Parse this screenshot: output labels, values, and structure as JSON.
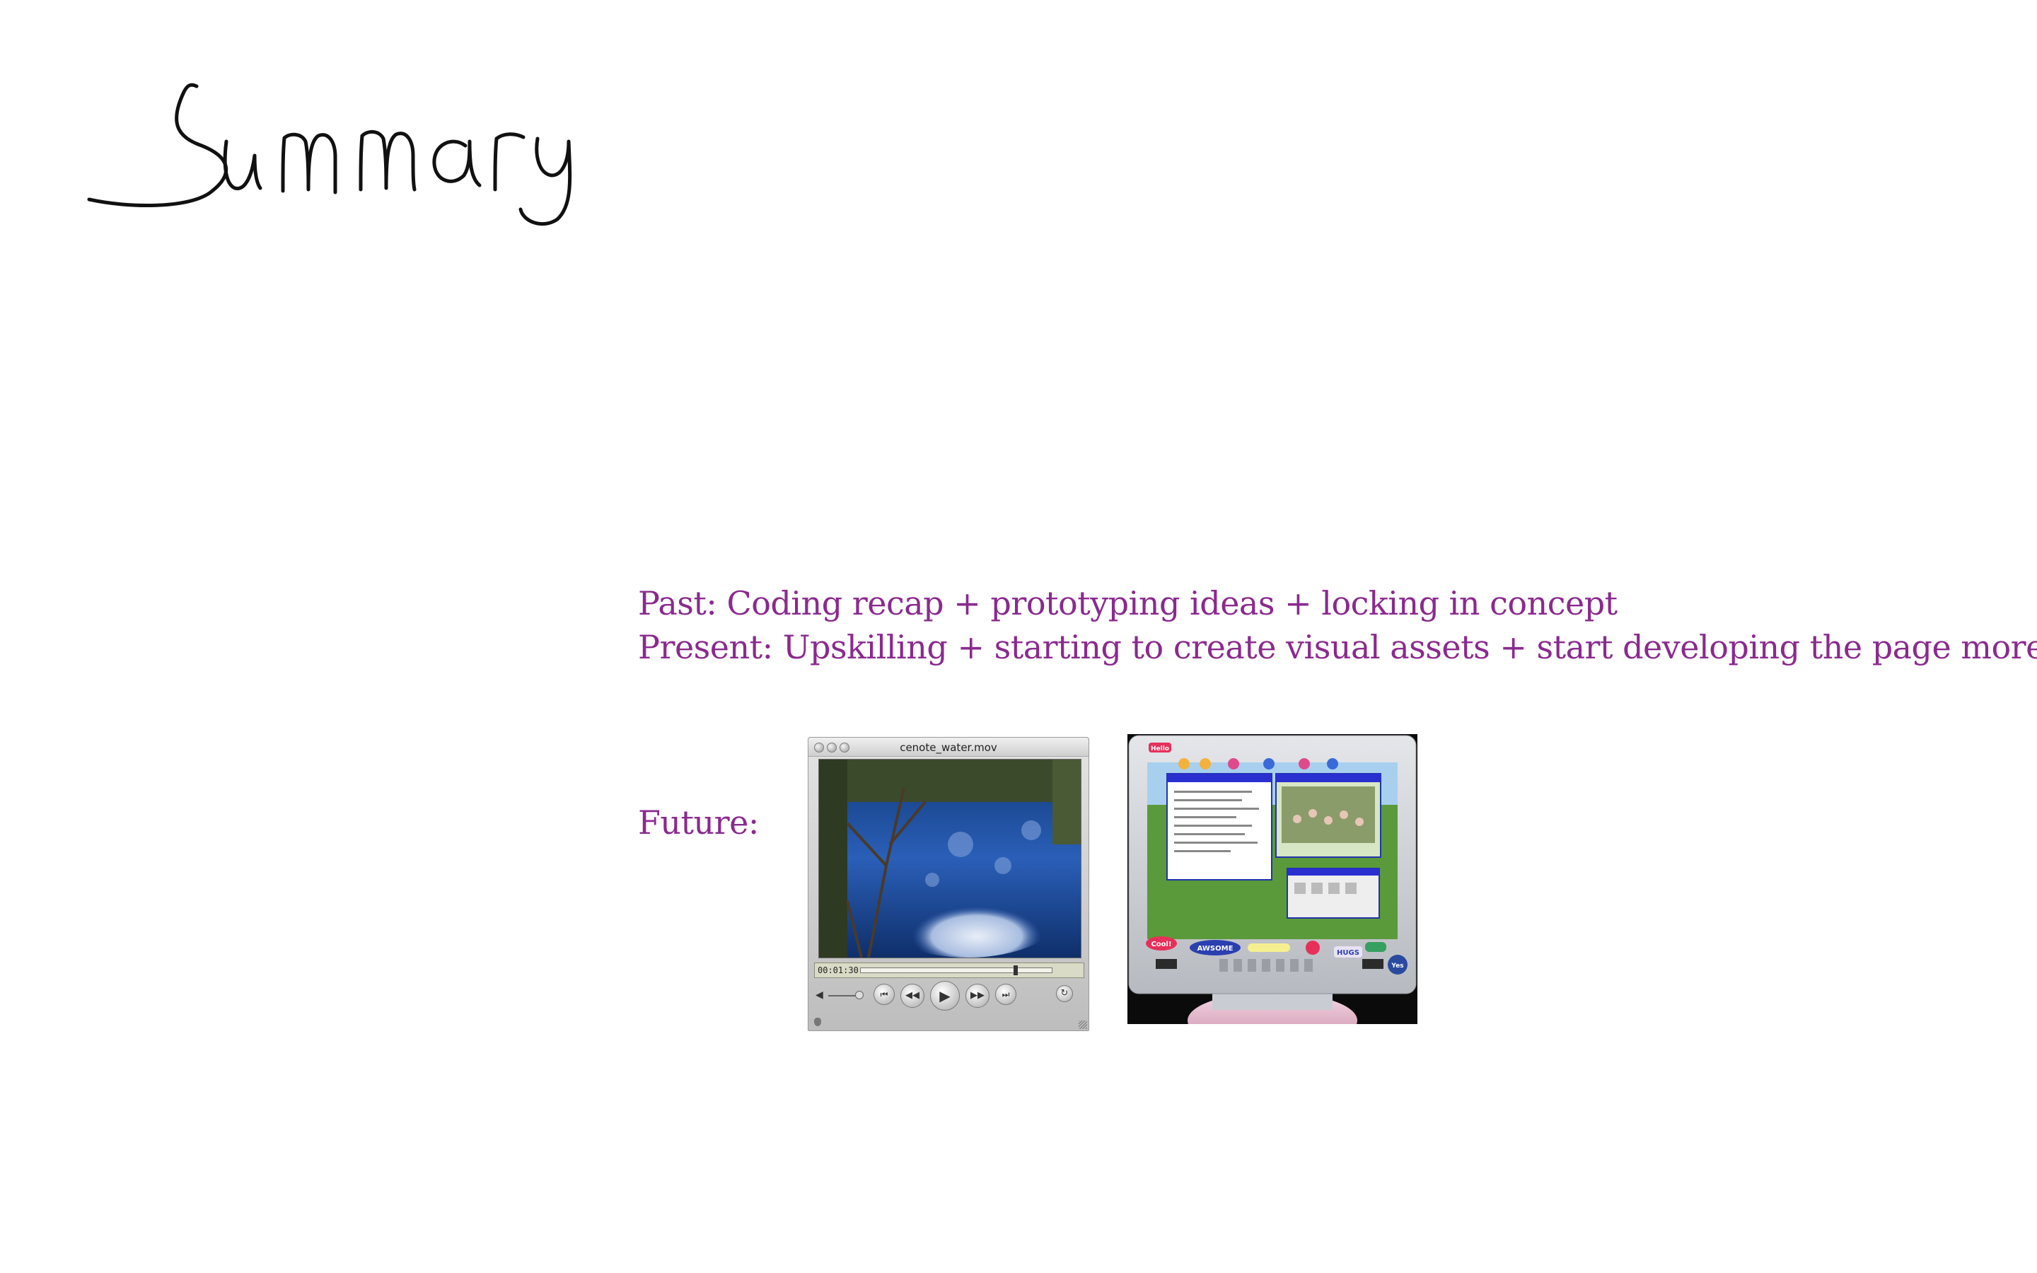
{
  "slide": {
    "title": "Summary",
    "past": "Past: Coding recap + prototyping ideas + locking in concept",
    "present": "Present: Upskilling + starting to create visual assets + start developing the page more",
    "future": "Future:"
  },
  "video_player": {
    "filename": "cenote_water.mov",
    "timecode": "00:01:30",
    "playback_progress": 0.8
  },
  "monitor_mockup": {
    "stickers": [
      "Hello",
      "Cool!",
      "AWSOME",
      "HUGS",
      "Yes"
    ]
  },
  "colors": {
    "text_accent": "#8a2a8e",
    "title_ink": "#111111",
    "background": "#ffffff"
  },
  "icons": {
    "play": "play-icon",
    "rewind": "rewind-icon",
    "fast_forward": "fast-forward-icon",
    "skip_start": "skip-start-icon",
    "skip_end": "skip-end-icon",
    "volume": "volume-icon",
    "loop": "loop-icon"
  }
}
